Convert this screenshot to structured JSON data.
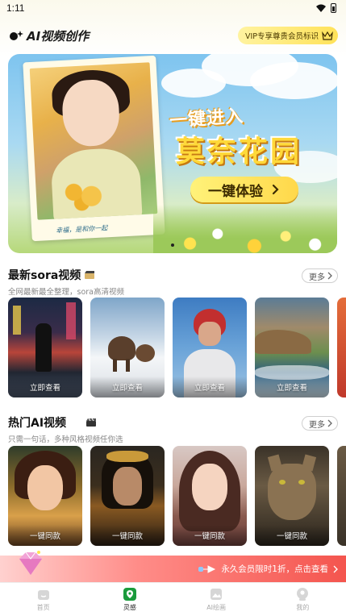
{
  "status_bar": {
    "time": "1:11"
  },
  "header": {
    "app_title": "AI视频创作",
    "vip_badge": "VIP专享尊贵会员标识"
  },
  "banner": {
    "photo_caption": "幸福，是和你一起",
    "headline_line1": "一键进入",
    "headline_line2": "莫奈花园",
    "cta_label": "一键体验",
    "active_dot": 1,
    "dot_count": 1
  },
  "sora_section": {
    "title": "最新sora视频",
    "subtitle": "全网最新最全整理，sora高清视频",
    "more_label": "更多",
    "cards": [
      {
        "label": "立即查看",
        "scene": "neon-city-street"
      },
      {
        "label": "立即查看",
        "scene": "mammoths-in-snow"
      },
      {
        "label": "立即查看",
        "scene": "astronaut-portrait"
      },
      {
        "label": "立即查看",
        "scene": "rocky-coastline"
      }
    ]
  },
  "ai_section": {
    "title": "热门AI视频",
    "subtitle": "只需一句话，多种风格视频任你选",
    "more_label": "更多",
    "cards": [
      {
        "label": "一键同款",
        "scene": "fantasy-girl-golden"
      },
      {
        "label": "一键同款",
        "scene": "warrior-man-dark"
      },
      {
        "label": "一键同款",
        "scene": "anime-girl-portrait"
      },
      {
        "label": "一键同款",
        "scene": "tabby-cat"
      }
    ]
  },
  "promo": {
    "text": "永久会员限时1折，点击查看"
  },
  "nav": {
    "items": [
      {
        "label": "首页",
        "icon": "home-icon",
        "active": false
      },
      {
        "label": "灵感",
        "icon": "inspiration-icon",
        "active": true
      },
      {
        "label": "AI绘画",
        "icon": "ai-painting-icon",
        "active": false
      },
      {
        "label": "我的",
        "icon": "profile-icon",
        "active": false
      }
    ]
  },
  "colors": {
    "vip_gold": "#ffe259",
    "promo_red": "#f4554e",
    "nav_active": "#1a9b3c"
  }
}
